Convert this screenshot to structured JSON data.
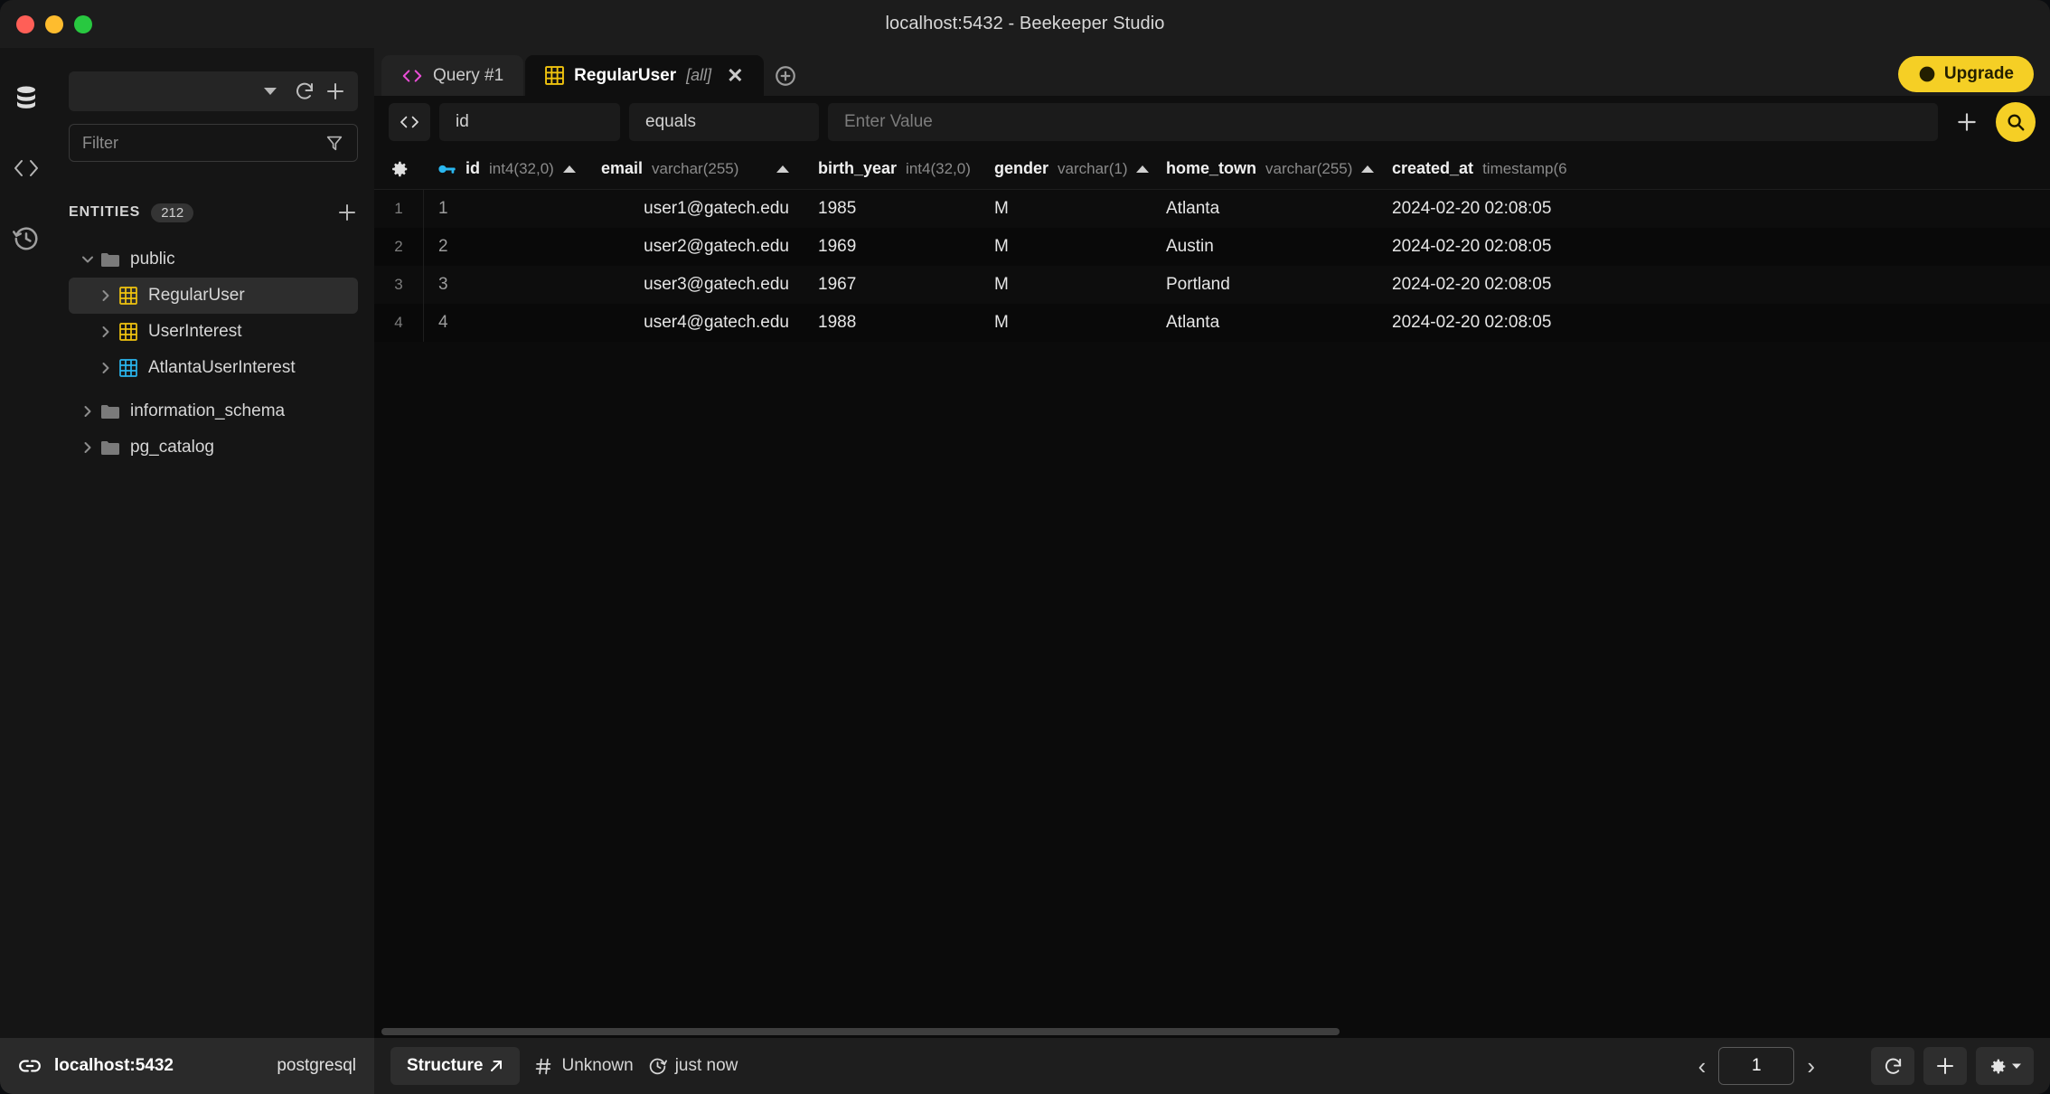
{
  "window": {
    "title": "localhost:5432 - Beekeeper Studio"
  },
  "rail": {
    "database_icon": "database-icon",
    "query_icon": "code-brackets-icon",
    "history_icon": "history-icon"
  },
  "sidebar": {
    "connection_value": "",
    "refresh_icon": "refresh-icon",
    "add_icon": "plus-icon",
    "filter_placeholder": "Filter",
    "filter_value": "",
    "filter_icon": "funnel-icon",
    "entities_label": "ENTITIES",
    "entities_count": "212",
    "tree": [
      {
        "label": "public",
        "type": "schema",
        "expanded": true,
        "indent": 0
      },
      {
        "label": "RegularUser",
        "type": "table",
        "selected": true,
        "indent": 1,
        "color": "#f1c40f"
      },
      {
        "label": "UserInterest",
        "type": "table",
        "selected": false,
        "indent": 1,
        "color": "#f1c40f"
      },
      {
        "label": "AtlantaUserInterest",
        "type": "view",
        "selected": false,
        "indent": 1,
        "color": "#2ab7f0"
      },
      {
        "label": "information_schema",
        "type": "schema",
        "expanded": false,
        "indent": 0
      },
      {
        "label": "pg_catalog",
        "type": "schema",
        "expanded": false,
        "indent": 0
      }
    ]
  },
  "tabs": [
    {
      "label": "Query #1",
      "suffix": "",
      "icon": "code-brackets-icon",
      "active": false,
      "closable": false
    },
    {
      "label": "RegularUser",
      "suffix": "[all]",
      "icon": "table-icon",
      "active": true,
      "closable": true
    }
  ],
  "tabbar": {
    "add_tab_icon": "plus-circle-icon",
    "upgrade_label": "Upgrade",
    "upgrade_icon": "upgrade-icon",
    "upgrade_color": "#f5cf25"
  },
  "filterstrip": {
    "code_toggle_icon": "code-brackets-icon",
    "column_value": "id",
    "operator_value": "equals",
    "value_placeholder": "Enter Value",
    "value_value": "",
    "add_filter_icon": "plus-icon",
    "search_icon": "search-icon"
  },
  "table": {
    "gear_icon": "gear-icon",
    "columns": [
      {
        "name": "id",
        "dtype": "int4(32,0)",
        "primary_key": true,
        "sortable": true,
        "align": "left"
      },
      {
        "name": "email",
        "dtype": "varchar(255)",
        "primary_key": false,
        "sortable": true,
        "align": "right"
      },
      {
        "name": "birth_year",
        "dtype": "int4(32,0)",
        "primary_key": false,
        "sortable": true,
        "align": "left"
      },
      {
        "name": "gender",
        "dtype": "varchar(1)",
        "primary_key": false,
        "sortable": true,
        "align": "left"
      },
      {
        "name": "home_town",
        "dtype": "varchar(255)",
        "primary_key": false,
        "sortable": true,
        "align": "left"
      },
      {
        "name": "created_at",
        "dtype": "timestamp(6",
        "primary_key": false,
        "sortable": false,
        "align": "left"
      }
    ],
    "rows": [
      {
        "num": "1",
        "id": "1",
        "email": "user1@gatech.edu",
        "birth_year": "1985",
        "gender": "M",
        "home_town": "Atlanta",
        "created_at": "2024-02-20 02:08:05"
      },
      {
        "num": "2",
        "id": "2",
        "email": "user2@gatech.edu",
        "birth_year": "1969",
        "gender": "M",
        "home_town": "Austin",
        "created_at": "2024-02-20 02:08:05"
      },
      {
        "num": "3",
        "id": "3",
        "email": "user3@gatech.edu",
        "birth_year": "1967",
        "gender": "M",
        "home_town": "Portland",
        "created_at": "2024-02-20 02:08:05"
      },
      {
        "num": "4",
        "id": "4",
        "email": "user4@gatech.edu",
        "birth_year": "1988",
        "gender": "M",
        "home_town": "Atlanta",
        "created_at": "2024-02-20 02:08:05"
      }
    ]
  },
  "statusbar": {
    "link_icon": "link-icon",
    "connection_name": "localhost:5432",
    "connection_type": "postgresql",
    "structure_label": "Structure",
    "structure_icon": "arrow-up-right-icon",
    "rowcount_icon": "hash-icon",
    "rowcount_label": "Unknown",
    "refreshed_icon": "clock-refresh-icon",
    "refreshed_label": "just now",
    "prev_page_icon": "chevron-left-icon",
    "page_number": "1",
    "next_page_icon": "chevron-right-icon",
    "refresh_icon": "refresh-icon",
    "add_row_icon": "plus-icon",
    "settings_icon": "gear-icon",
    "settings_caret_icon": "chevron-down-icon"
  }
}
